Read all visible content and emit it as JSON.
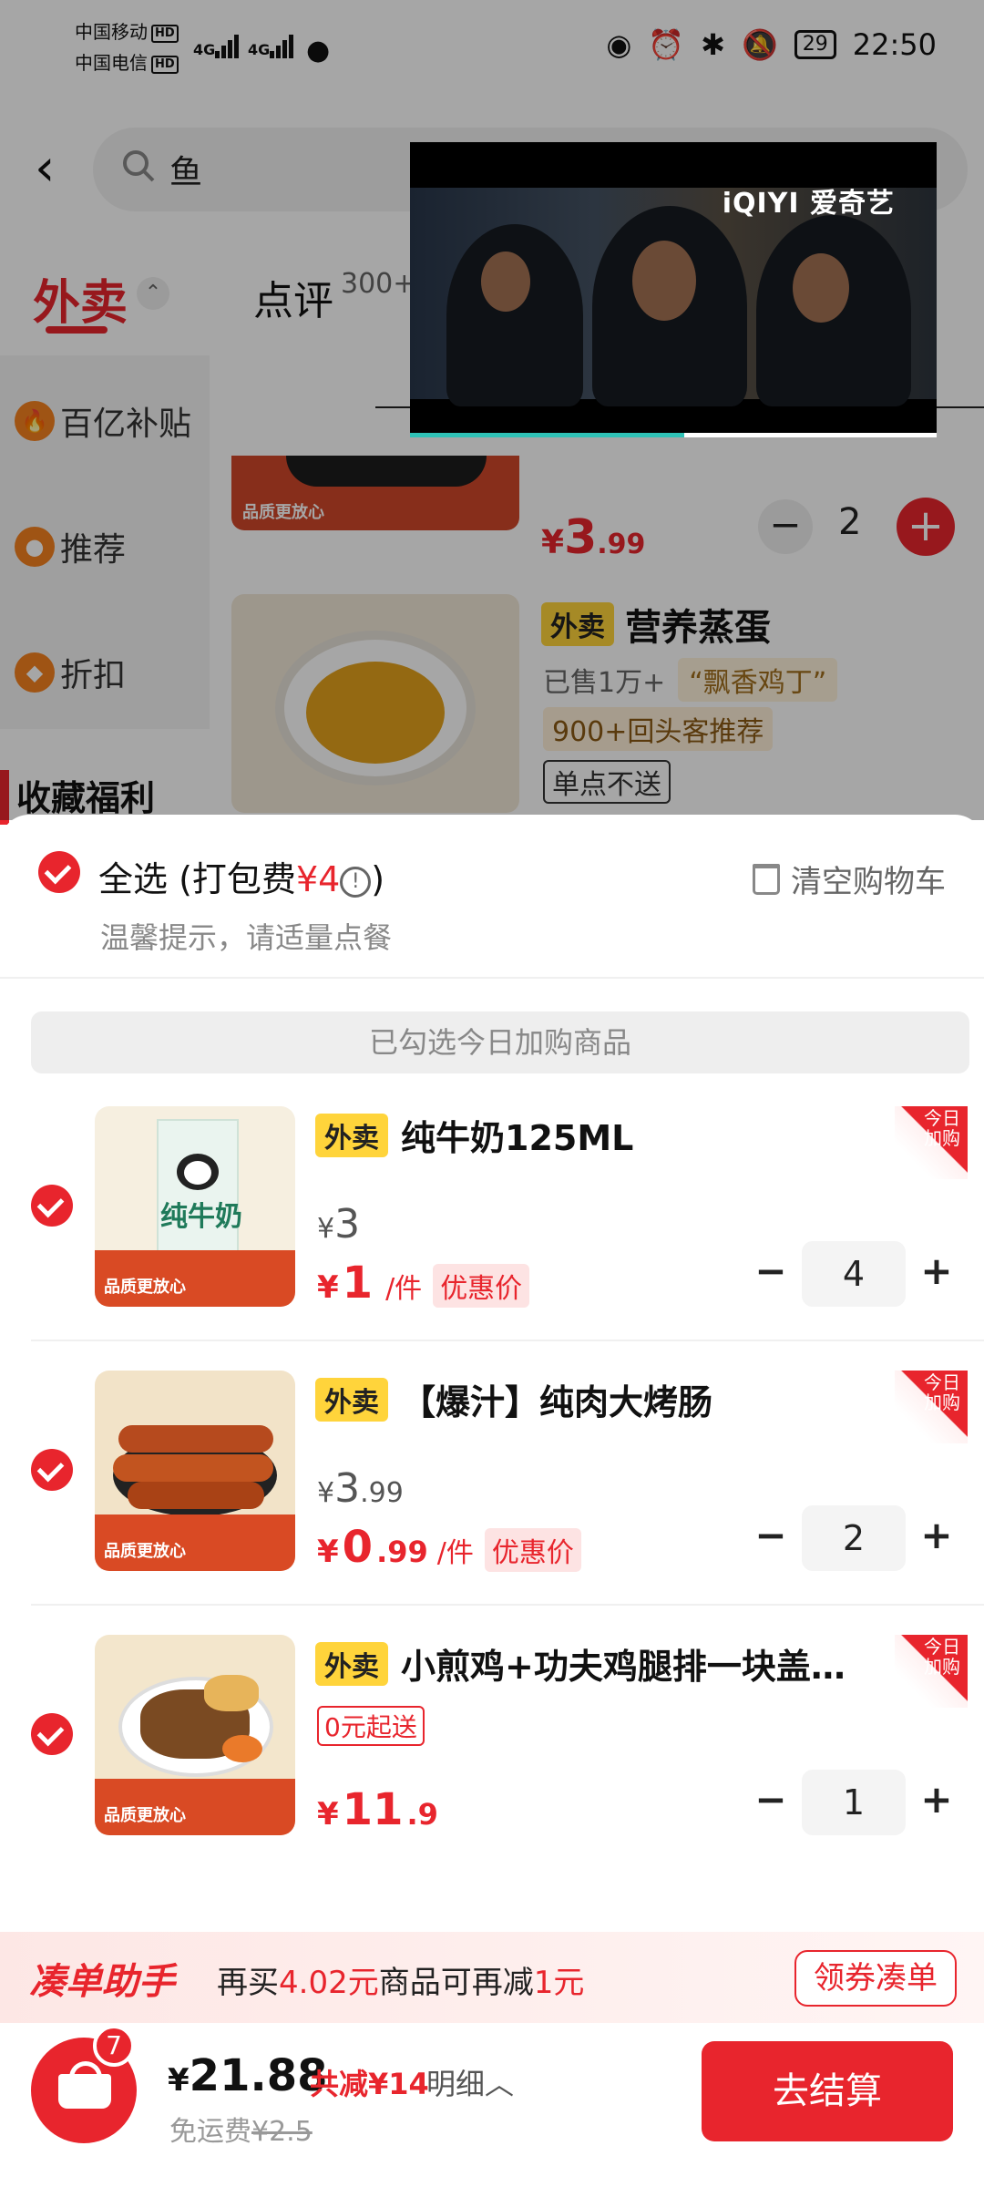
{
  "status_bar": {
    "carrier1": "中国移动",
    "carrier2": "中国电信",
    "hd": "HD",
    "net1": "4G",
    "net2": "4G",
    "battery": "29",
    "time": "22:50"
  },
  "header": {
    "search_query": "鱼"
  },
  "tabs": {
    "waimai": "外卖",
    "dianping": "点评",
    "dianping_count": "300+"
  },
  "sidebar": {
    "items": [
      "百亿补贴",
      "推荐",
      "折扣"
    ],
    "collect": "收藏福利"
  },
  "video": {
    "brand": "iQIYI 爱奇艺",
    "progress": 0.52
  },
  "bg_products": {
    "top_price_yen": "¥",
    "top_price_big": "3",
    "top_price_small": ".99",
    "top_qty": "2",
    "brand_mini": "品质更放心",
    "egg_tag": "外卖",
    "egg_name": "营养蒸蛋",
    "egg_sold": "已售1万+",
    "egg_flavor": "“飘香鸡丁”",
    "egg_rec": "900+回头客推荐",
    "egg_no": "单点不送"
  },
  "cart": {
    "select_all": "全选",
    "pack_fee_prefix": "(打包费",
    "pack_fee": "¥4",
    "pack_fee_suffix": ")",
    "clear": "清空购物车",
    "tip": "温馨提示，请适量点餐",
    "today_banner": "已勾选今日加购商品",
    "today_badge_1": "今日",
    "today_badge_2": "加购",
    "items": [
      {
        "tag": "外卖",
        "name": "纯牛奶125ML",
        "orig_yen": "¥",
        "orig_big": "3",
        "orig_small": "",
        "now_yen": "¥",
        "now_big": "1",
        "now_small": "",
        "per": "/件",
        "discount": "优惠价",
        "qty": "4"
      },
      {
        "tag": "外卖",
        "name": "【爆汁】纯肉大烤肠",
        "orig_yen": "¥",
        "orig_big": "3",
        "orig_small": ".99",
        "now_yen": "¥",
        "now_big": "0",
        "now_small": ".99",
        "per": "/件",
        "discount": "优惠价",
        "qty": "2"
      },
      {
        "tag": "外卖",
        "name": "小煎鸡+功夫鸡腿排一块盖…",
        "zero": "0元起送",
        "now_yen": "¥",
        "now_big": "11",
        "now_small": ".9",
        "qty": "1"
      }
    ]
  },
  "helper": {
    "title": "凑单助手",
    "text1": "再买",
    "amount": "4.02元",
    "text2": "商品可再减",
    "reduce": "1元",
    "button": "领券凑单"
  },
  "bottom": {
    "badge": "7",
    "total_yen": "¥",
    "total": "21.88",
    "saved": "共减¥14",
    "detail": "明细︿",
    "ship_label": "免运费",
    "ship_old": "¥2.5",
    "pay": "去结算"
  },
  "colors": {
    "accent": "#e8252d",
    "tag_yellow": "#ffd43b"
  }
}
